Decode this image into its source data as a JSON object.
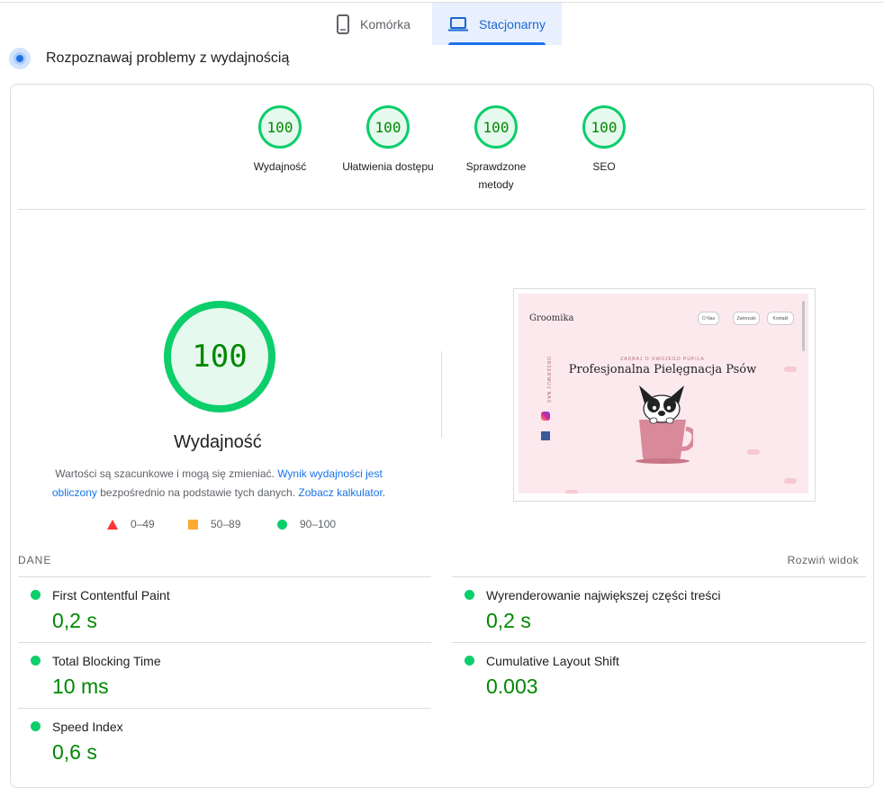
{
  "tabs": {
    "mobile": "Komórka",
    "desktop": "Stacjonarny"
  },
  "diagnose_title": "Rozpoznawaj problemy z wydajnością",
  "scores": [
    {
      "label": "Wydajność",
      "value": "100"
    },
    {
      "label": "Ułatwienia dostępu",
      "value": "100"
    },
    {
      "label": "Sprawdzone metody",
      "value": "100"
    },
    {
      "label": "SEO",
      "value": "100"
    }
  ],
  "performance": {
    "score": "100",
    "label": "Wydajność",
    "disclaimer_pre": "Wartości są szacunkowe i mogą się zmieniać. ",
    "disclaimer_link1": "Wynik wydajności jest obliczony",
    "disclaimer_mid": " bezpośrednio na podstawie tych danych. ",
    "disclaimer_link2": "Zobacz kalkulator",
    "disclaimer_end": "."
  },
  "legend": {
    "fail": "0–49",
    "average": "50–89",
    "pass": "90–100"
  },
  "screenshot": {
    "logo": "Groomika",
    "nav": [
      "O Nas",
      "Zwierzaki",
      "Kontakt"
    ],
    "kicker": "ZADBAJ O SWOJEGO PUPILA",
    "title": "Profesjonalna Pielęgnacja Psów",
    "side_label": "OBSERWUJ NAS"
  },
  "metrics_header": {
    "section": "DANE",
    "expand": "Rozwiń widok"
  },
  "metrics": [
    {
      "name": "First Contentful Paint",
      "value": "0,2 s"
    },
    {
      "name": "Wyrenderowanie największej części treści",
      "value": "0,2 s"
    },
    {
      "name": "Total Blocking Time",
      "value": "10 ms"
    },
    {
      "name": "Cumulative Layout Shift",
      "value": "0.003"
    },
    {
      "name": "Speed Index",
      "value": "0,6 s"
    }
  ],
  "colors": {
    "pass": "#0cce6b",
    "pass_text": "#008800",
    "average": "#ffaa33",
    "fail": "#ff3333",
    "accent": "#1a73e8"
  }
}
